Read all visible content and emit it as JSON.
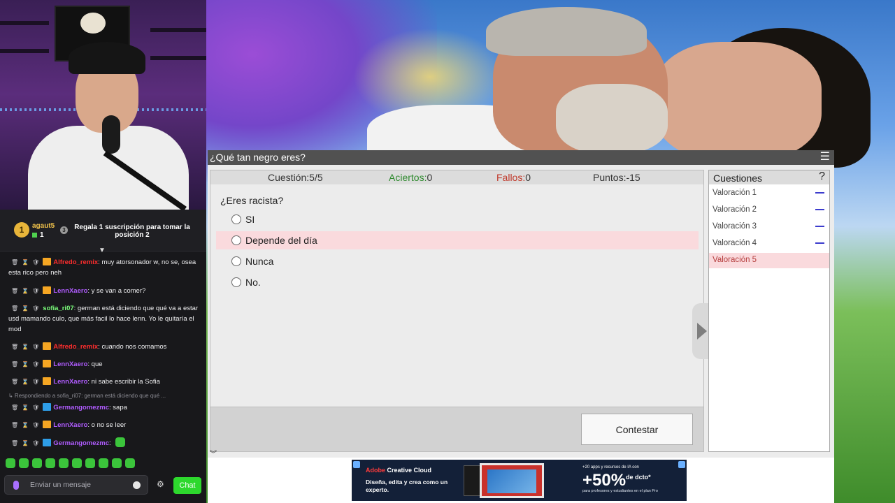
{
  "chat": {
    "pinned": {
      "rank": "1",
      "user": "agaut5",
      "count": "1",
      "badge": "3",
      "text": "Regala 1 suscripción para tomar la posición 2"
    },
    "messages": [
      {
        "user": "Alfredo_remix",
        "color": "#ff2d2d",
        "text": ": muy atorsonador w, no se, osea esta rico pero neh",
        "badge": "crown"
      },
      {
        "user": "LennXaero",
        "color": "#b05cff",
        "text": ": y se van a comer?",
        "badge": "crown"
      },
      {
        "user": "sofia_ri07",
        "color": "#7cff7c",
        "text": ": german está diciendo que qué va a estar usd mamando culo, que más facil lo hace lenn. Yo le quitaría el mod",
        "badge": "none"
      },
      {
        "user": "Alfredo_remix",
        "color": "#ff2d2d",
        "text": ": cuando nos comamos",
        "badge": "crown"
      },
      {
        "user": "LennXaero",
        "color": "#b05cff",
        "text": ": que",
        "badge": "crown"
      },
      {
        "user": "LennXaero",
        "color": "#b05cff",
        "text": ": ni sabe escribir la Sofia",
        "badge": "crown"
      },
      {
        "user": "Germangomezmc",
        "color": "#b05cff",
        "text": ": sapa",
        "badge": "blue"
      },
      {
        "user": "LennXaero",
        "color": "#b05cff",
        "text": ": o no se leer",
        "badge": "crown"
      },
      {
        "user": "Germangomezmc",
        "color": "#b05cff",
        "text": ":",
        "badge": "blue"
      }
    ],
    "reply_preview": "↳ Respondiendo a sofia_ri07: german está diciendo que qué ...",
    "input_placeholder": "Enviar un mensaje",
    "send_label": "Chat"
  },
  "quiz": {
    "title": "¿Qué tan negro eres?",
    "stats": {
      "question_label": "Cuestión:",
      "question_value": "5/5",
      "correct_label": "Aciertos:",
      "correct_value": "0",
      "wrong_label": "Fallos:",
      "wrong_value": "0",
      "points_label": "Puntos:",
      "points_value": "-15"
    },
    "question": "¿Eres racista?",
    "options": [
      "SI",
      "Depende del día",
      "Nunca",
      "No."
    ],
    "highlighted_option": 1,
    "answer_button": "Contestar",
    "side_title": "Cuestiones",
    "side_help": "?",
    "side_items": [
      "Valoración 1",
      "Valoración 2",
      "Valoración 3",
      "Valoración 4",
      "Valoración 5"
    ],
    "colors": {
      "correct": "#2f8a2f",
      "wrong": "#c0392b",
      "highlight": "#fadadd"
    }
  },
  "ad": {
    "brand_prefix": "Adobe",
    "brand": "Creative Cloud",
    "slogan": "Diseña, edita y crea como un experto.",
    "small_text": "+20 apps y recursos de IA con",
    "discount": "+50%",
    "discount_suffix": "de dcto*",
    "fine_print": "para profesores y estudiantes en el plan Pro"
  }
}
